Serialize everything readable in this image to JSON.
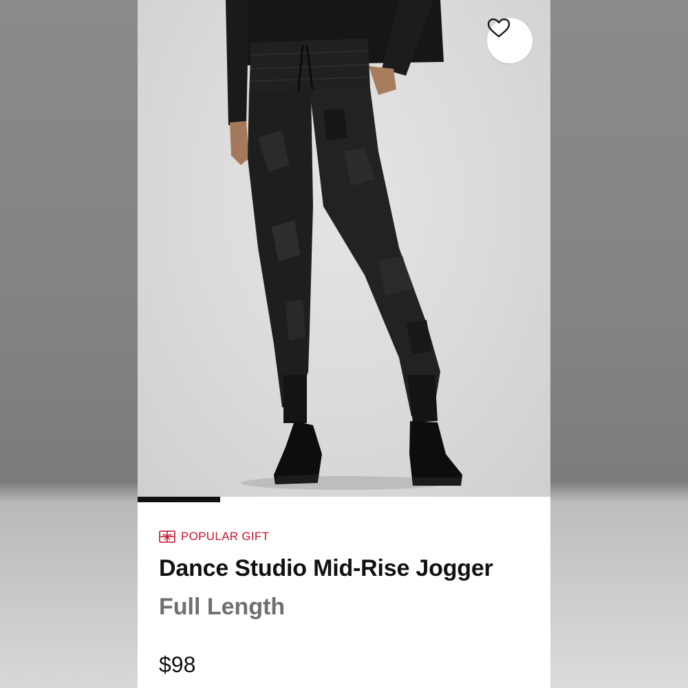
{
  "product": {
    "badge_label": "POPULAR GIFT",
    "badge_icon": "gift-icon",
    "name": "Dance Studio Mid-Rise Jogger",
    "length": "Full Length",
    "price": "$98"
  },
  "wishlist": {
    "icon": "heart-outline-icon"
  },
  "carousel": {
    "current_image": 1,
    "progress": 0.2
  },
  "colors": {
    "accent": "#c8102e",
    "text": "#111111",
    "muted": "#6f6f6f"
  }
}
